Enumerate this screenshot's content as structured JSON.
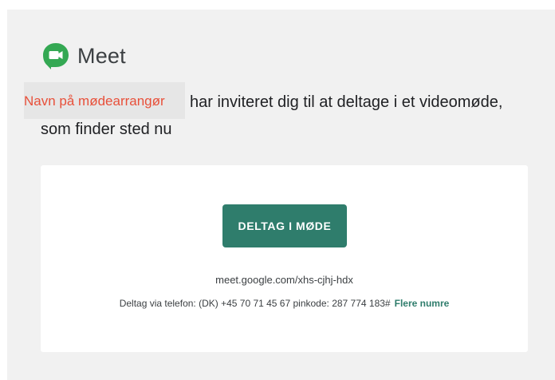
{
  "brand": {
    "name": "Meet",
    "icon": "google-meet-icon",
    "colors": {
      "icon_green": "#34a853",
      "accent": "#2f7d6c",
      "organizer_placeholder": "#e8503a"
    }
  },
  "invitation": {
    "organizer_placeholder": "Navn på mødearrangør",
    "line1": "har inviteret dig til at deltage i et videomøde,",
    "line2": "som finder sted nu"
  },
  "card": {
    "join_button_label": "DELTAG I MØDE",
    "meeting_link": "meet.google.com/xhs-cjhj-hdx",
    "phone_text": "Deltag via telefon: (DK) +45 70 71 45 67 pinkode: 287 774 183#",
    "more_numbers_label": "Flere numre"
  }
}
